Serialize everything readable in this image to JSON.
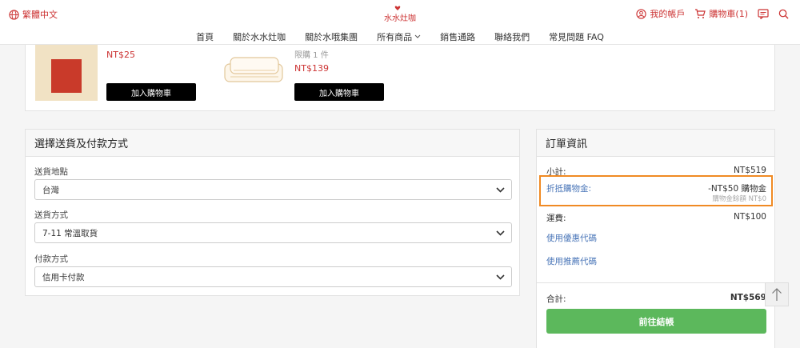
{
  "header": {
    "language": "繁體中文",
    "logo_text": "水水灶咖",
    "account": "我的帳戶",
    "cart": "購物車(1)"
  },
  "nav": {
    "items": [
      "首頁",
      "關於水水灶咖",
      "關於水哦集團",
      "所有商品",
      "銷售通路",
      "聯絡我們",
      "常見問題 FAQ"
    ]
  },
  "products": [
    {
      "price": "NT$25",
      "limit": "",
      "button": "加入購物車"
    },
    {
      "price": "NT$139",
      "limit": "限購 1 件",
      "button": "加入購物車"
    }
  ],
  "shipping": {
    "title": "選擇送貨及付款方式",
    "fields": [
      {
        "label": "送貨地點",
        "value": "台灣"
      },
      {
        "label": "送貨方式",
        "value": "7-11 常溫取貨"
      },
      {
        "label": "付款方式",
        "value": "信用卡付款"
      }
    ]
  },
  "order": {
    "title": "訂單資訊",
    "subtotal_label": "小計:",
    "subtotal_value": "NT$519",
    "credit_label": "折抵購物金:",
    "credit_value": "-NT$50 購物金",
    "credit_balance": "購物金餘額 NT$0",
    "shipping_label": "運費:",
    "shipping_value": "NT$100",
    "coupon_link": "使用優惠代碼",
    "referral_link": "使用推薦代碼",
    "total_label": "合計:",
    "total_value": "NT$569",
    "checkout_button": "前往結帳"
  },
  "colors": {
    "accent": "#cc3333",
    "checkout": "#5cb85c",
    "highlight": "#f08a24",
    "link": "#4a76b8"
  }
}
